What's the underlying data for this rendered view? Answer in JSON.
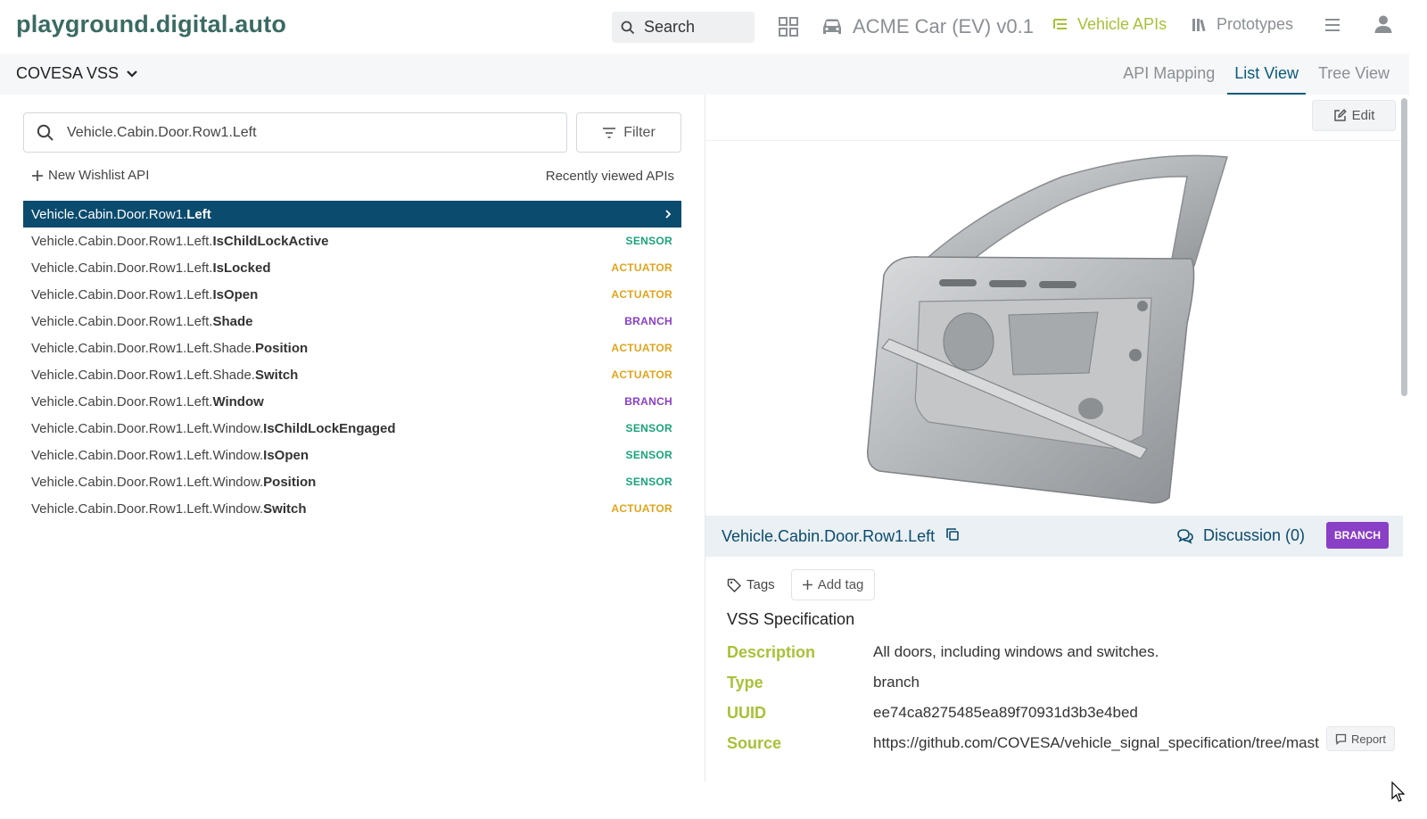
{
  "header": {
    "logo": "playground.digital.auto",
    "search_label": "Search",
    "car_model": "ACME Car (EV) v0.1",
    "nav_vehicle_apis": "Vehicle APIs",
    "nav_prototypes": "Prototypes"
  },
  "subheader": {
    "spec_selector": "COVESA VSS",
    "tabs": [
      {
        "label": "API Mapping",
        "active": false
      },
      {
        "label": "List View",
        "active": true
      },
      {
        "label": "Tree View",
        "active": false
      }
    ]
  },
  "left": {
    "search_value": "Vehicle.Cabin.Door.Row1.Left",
    "filter_label": "Filter",
    "new_wishlist": "New Wishlist API",
    "recently_viewed": "Recently viewed APIs",
    "apis": [
      {
        "prefix": "Vehicle.Cabin.Door.Row1.",
        "bold": "Left",
        "type": "",
        "selected": true
      },
      {
        "prefix": "Vehicle.Cabin.Door.Row1.Left.",
        "bold": "IsChildLockActive",
        "type": "SENSOR"
      },
      {
        "prefix": "Vehicle.Cabin.Door.Row1.Left.",
        "bold": "IsLocked",
        "type": "ACTUATOR"
      },
      {
        "prefix": "Vehicle.Cabin.Door.Row1.Left.",
        "bold": "IsOpen",
        "type": "ACTUATOR"
      },
      {
        "prefix": "Vehicle.Cabin.Door.Row1.Left.",
        "bold": "Shade",
        "type": "BRANCH"
      },
      {
        "prefix": "Vehicle.Cabin.Door.Row1.Left.Shade.",
        "bold": "Position",
        "type": "ACTUATOR"
      },
      {
        "prefix": "Vehicle.Cabin.Door.Row1.Left.Shade.",
        "bold": "Switch",
        "type": "ACTUATOR"
      },
      {
        "prefix": "Vehicle.Cabin.Door.Row1.Left.",
        "bold": "Window",
        "type": "BRANCH"
      },
      {
        "prefix": "Vehicle.Cabin.Door.Row1.Left.Window.",
        "bold": "IsChildLockEngaged",
        "type": "SENSOR"
      },
      {
        "prefix": "Vehicle.Cabin.Door.Row1.Left.Window.",
        "bold": "IsOpen",
        "type": "SENSOR"
      },
      {
        "prefix": "Vehicle.Cabin.Door.Row1.Left.Window.",
        "bold": "Position",
        "type": "SENSOR"
      },
      {
        "prefix": "Vehicle.Cabin.Door.Row1.Left.Window.",
        "bold": "Switch",
        "type": "ACTUATOR"
      }
    ]
  },
  "right": {
    "edit_label": "Edit",
    "api_name": "Vehicle.Cabin.Door.Row1.Left",
    "discussion": "Discussion (0)",
    "badge": "BRANCH",
    "tags_label": "Tags",
    "add_tag": "Add tag",
    "spec_title": "VSS Specification",
    "spec": [
      {
        "key": "Description",
        "value": "All doors, including windows and switches."
      },
      {
        "key": "Type",
        "value": "branch"
      },
      {
        "key": "UUID",
        "value": "ee74ca8275485ea89f70931d3b3e4bed"
      },
      {
        "key": "Source",
        "value": "https://github.com/COVESA/vehicle_signal_specification/tree/master"
      }
    ],
    "report_label": "Report"
  },
  "colors": {
    "primary": "#0b4b6e",
    "accent": "#a9c038",
    "sensor": "#1aa37a",
    "actuator": "#e0a41c",
    "branch": "#8a3fc7"
  }
}
